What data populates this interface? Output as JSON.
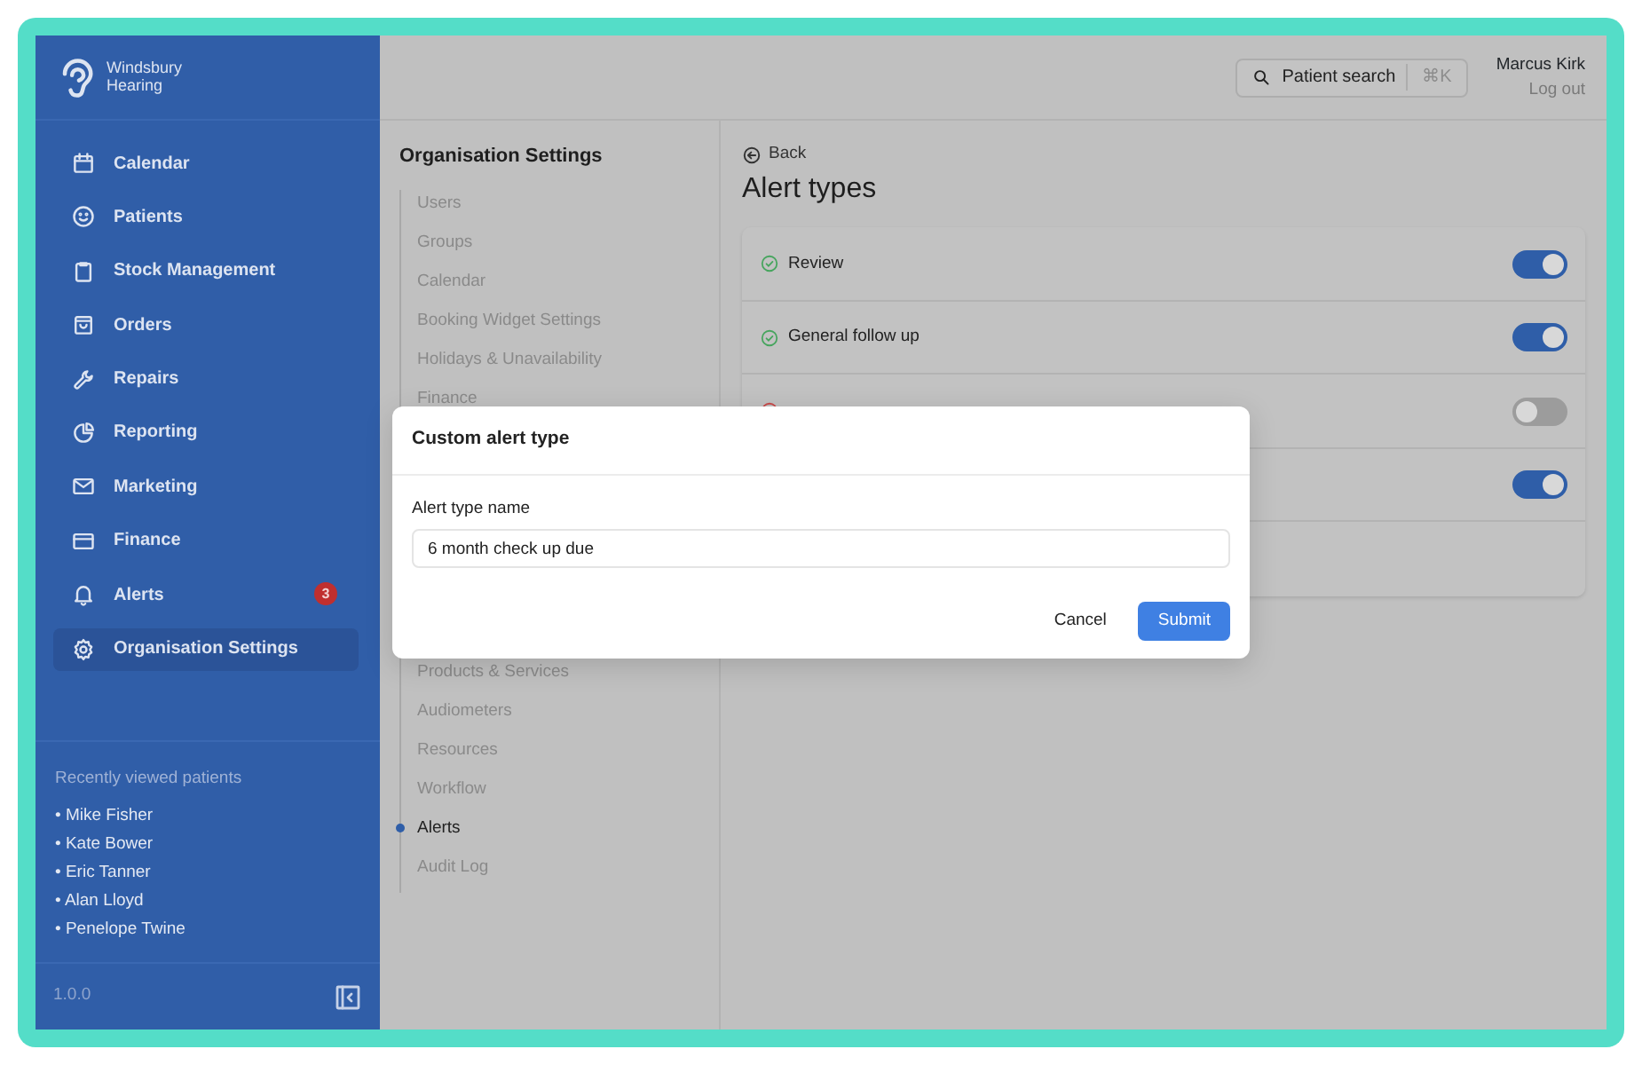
{
  "sidebar": {
    "brand": [
      "Windsbury",
      "Hearing"
    ],
    "items": [
      {
        "label": "Calendar",
        "selected": false
      },
      {
        "label": "Patients",
        "selected": false
      },
      {
        "label": "Stock Management",
        "selected": false
      },
      {
        "label": "Orders",
        "selected": false
      },
      {
        "label": "Repairs",
        "selected": false
      },
      {
        "label": "Reporting",
        "selected": false
      },
      {
        "label": "Marketing",
        "selected": false
      },
      {
        "label": "Finance",
        "selected": false
      },
      {
        "label": "Alerts",
        "selected": false,
        "badge": "3"
      },
      {
        "label": "Organisation Settings",
        "selected": true
      }
    ],
    "recent_title": "Recently viewed patients",
    "recent": [
      "• Mike Fisher",
      "• Kate Bower",
      "• Eric Tanner",
      "• Alan Lloyd",
      "• Penelope Twine"
    ],
    "version": "1.0.0"
  },
  "topbar": {
    "search_label": "Patient search",
    "shortcut": "⌘K",
    "user": "Marcus Kirk",
    "logout": "Log out"
  },
  "settings_nav": {
    "title": "Organisation Settings",
    "items_top": [
      {
        "label": "Users",
        "selected": false
      },
      {
        "label": "Groups",
        "selected": false
      },
      {
        "label": "Calendar",
        "selected": false
      },
      {
        "label": "Booking Widget Settings",
        "selected": false
      },
      {
        "label": "Holidays & Unavailability",
        "selected": false
      },
      {
        "label": "Finance",
        "selected": false
      }
    ],
    "items_bottom": [
      {
        "label": "Products & Services",
        "selected": false
      },
      {
        "label": "Audiometers",
        "selected": false
      },
      {
        "label": "Resources",
        "selected": false
      },
      {
        "label": "Workflow",
        "selected": false
      },
      {
        "label": "Alerts",
        "selected": true
      },
      {
        "label": "Audit Log",
        "selected": false
      }
    ]
  },
  "content": {
    "back": "Back",
    "title": "Alert types",
    "alert_types": [
      {
        "label": "Review",
        "kind": "check",
        "on": true
      },
      {
        "label": "General follow up",
        "kind": "check",
        "on": true
      },
      {
        "kind": "cross",
        "on": false
      },
      {
        "on": true
      }
    ]
  },
  "modal": {
    "title": "Custom alert type",
    "field_label": "Alert type name",
    "value": "6 month check up due",
    "cancel": "Cancel",
    "submit": "Submit"
  }
}
